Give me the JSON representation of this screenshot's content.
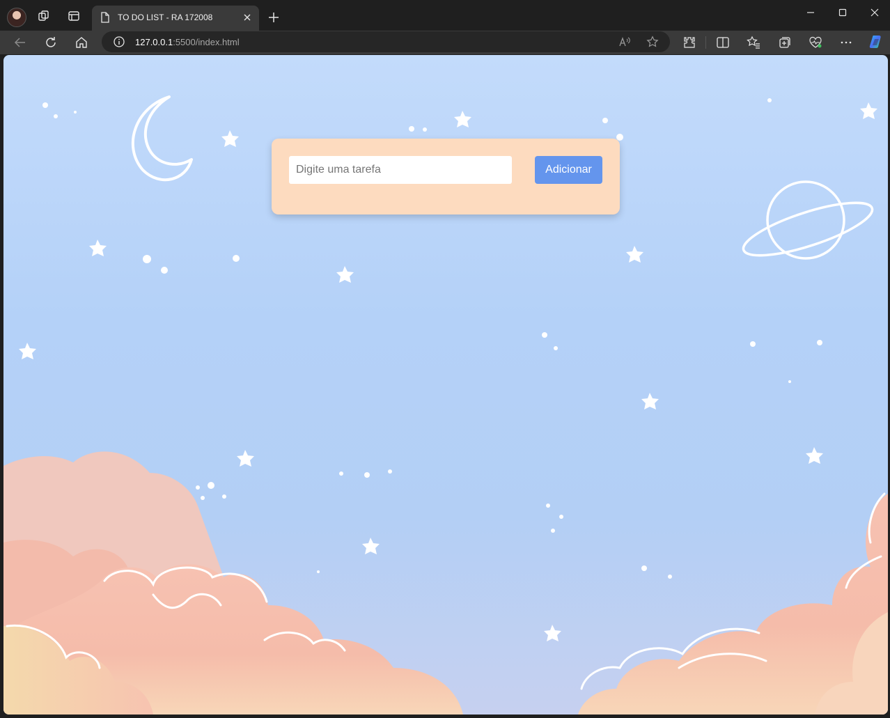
{
  "browser": {
    "tab": {
      "title": "TO DO LIST - RA 172008"
    },
    "address": {
      "host": "127.0.0.1",
      "rest": ":5500/index.html"
    },
    "icons": [
      "profile-avatar",
      "workspaces-icon",
      "tab-actions-icon",
      "page-icon",
      "close-icon",
      "plus-icon",
      "minimize-icon",
      "maximize-icon",
      "close-window-icon",
      "back-icon",
      "refresh-icon",
      "home-icon",
      "info-icon",
      "read-aloud-icon",
      "favorite-star-icon",
      "extensions-icon",
      "split-screen-icon",
      "favorites-icon",
      "collections-icon",
      "browser-essentials-icon",
      "more-icon",
      "copilot-icon"
    ]
  },
  "todo": {
    "input_placeholder": "Digite uma tarefa",
    "add_label": "Adicionar"
  },
  "colors": {
    "card": "#fddbbf",
    "button": "#6495ed",
    "sky": "#b4d1f8",
    "clouds": "#f6c3b3"
  }
}
